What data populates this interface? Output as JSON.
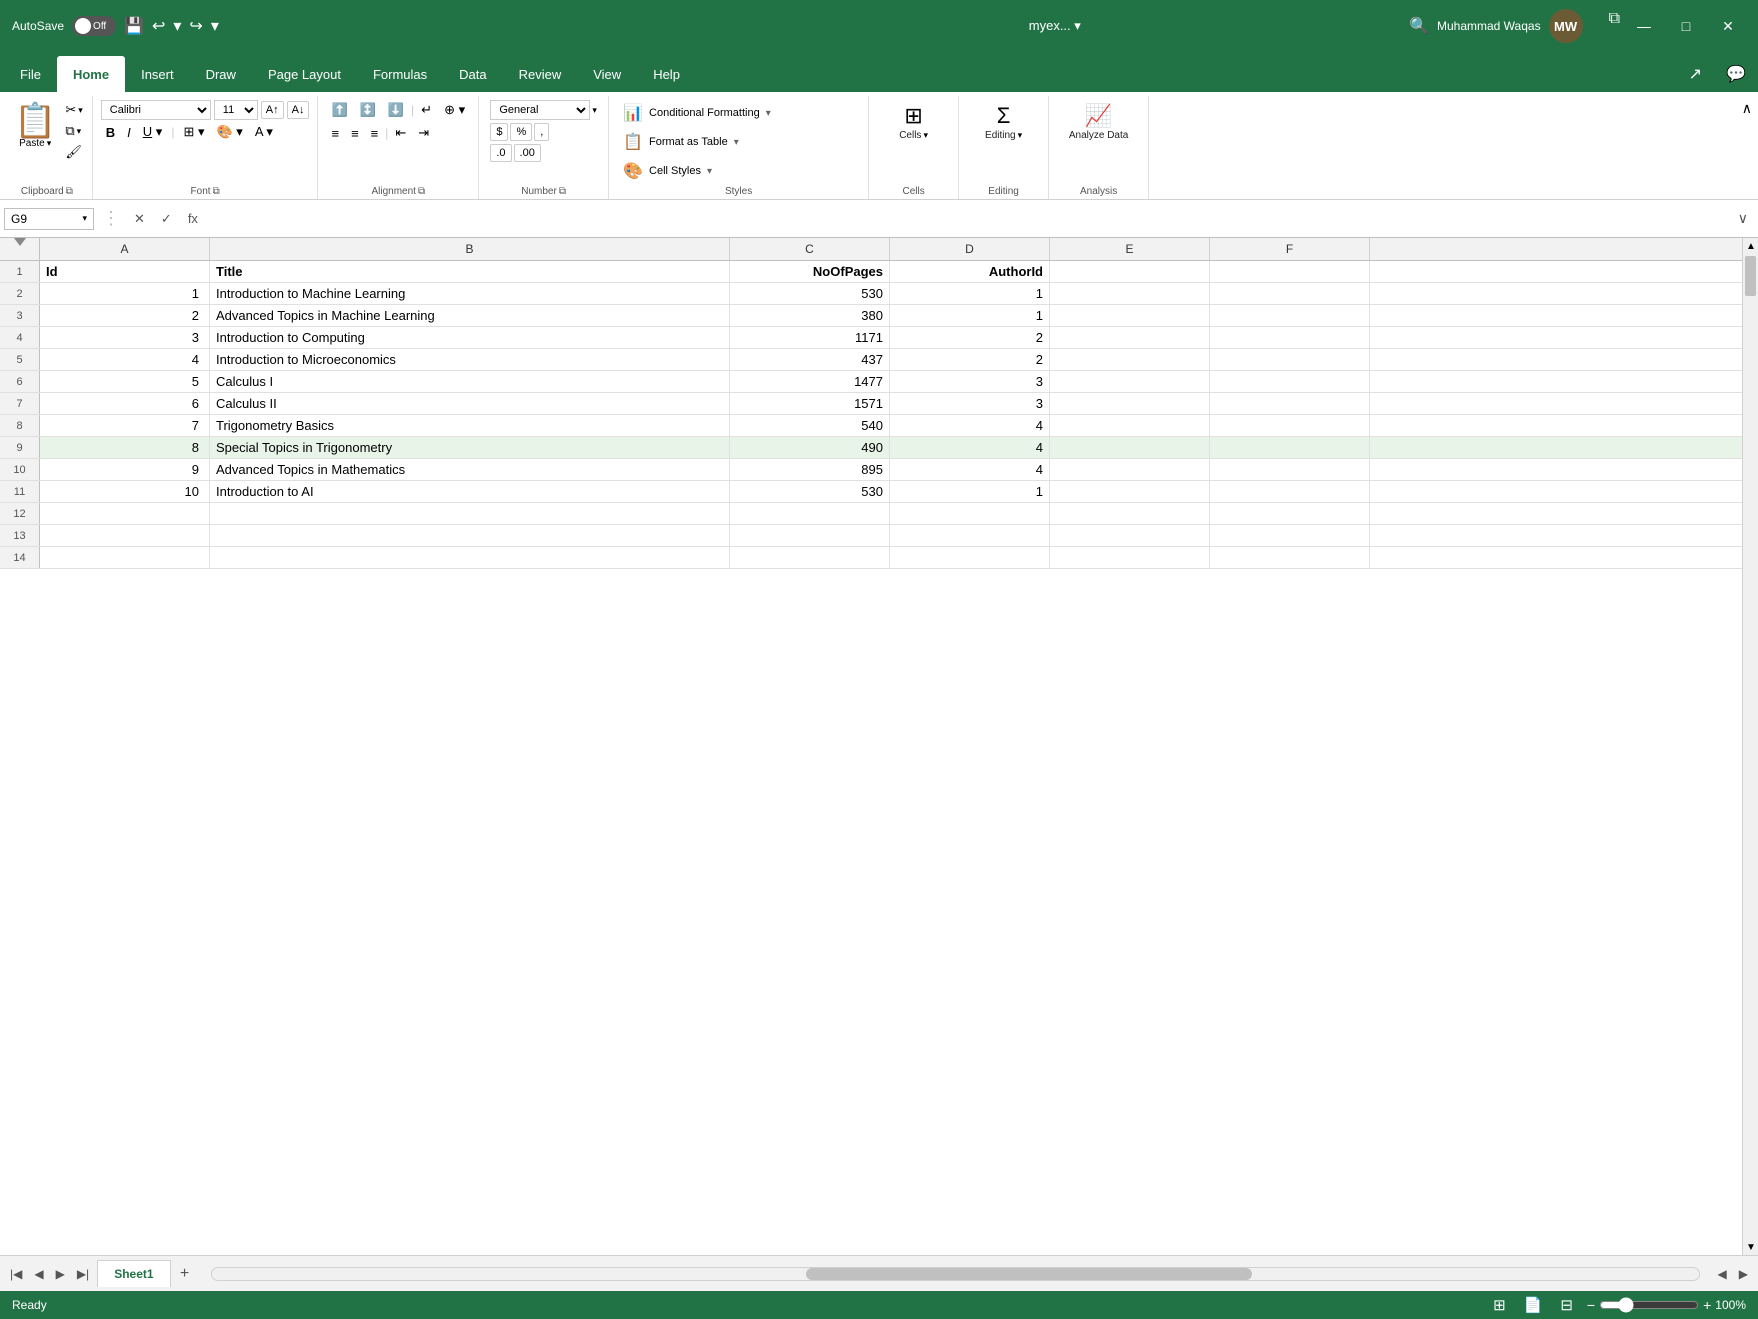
{
  "titlebar": {
    "autosave_label": "AutoSave",
    "toggle_state": "Off",
    "filename": "myex...",
    "search_placeholder": "Search",
    "username": "Muhammad Waqas",
    "user_initials": "MW"
  },
  "ribbon_tabs": {
    "tabs": [
      "File",
      "Home",
      "Insert",
      "Draw",
      "Page Layout",
      "Formulas",
      "Data",
      "Review",
      "View",
      "Help"
    ],
    "active_tab": "Home"
  },
  "ribbon": {
    "clipboard": {
      "group_label": "Clipboard",
      "paste_label": "Paste"
    },
    "font": {
      "group_label": "Font",
      "font_name": "Calibri",
      "font_size": "11",
      "bold": "B",
      "italic": "I",
      "underline": "U"
    },
    "alignment": {
      "group_label": "Alignment"
    },
    "number": {
      "group_label": "Number"
    },
    "styles": {
      "group_label": "Styles",
      "conditional_formatting": "Conditional Formatting",
      "format_as_table": "Format as Table",
      "cell_styles": "Cell Styles"
    },
    "cells": {
      "group_label": "Cells",
      "label": "Cells"
    },
    "editing": {
      "group_label": "Editing",
      "label": "Editing"
    },
    "analysis": {
      "group_label": "Analysis",
      "analyze_data": "Analyze Data"
    }
  },
  "formula_bar": {
    "cell_ref": "G9",
    "formula": "",
    "fx_label": "fx"
  },
  "spreadsheet": {
    "columns": [
      "A",
      "B",
      "C",
      "D",
      "E",
      "F"
    ],
    "headers": [
      "Id",
      "Title",
      "NoOfPages",
      "AuthorId",
      "",
      ""
    ],
    "rows": [
      {
        "row": 1,
        "cells": [
          "Id",
          "Title",
          "NoOfPages",
          "AuthorId",
          "",
          ""
        ]
      },
      {
        "row": 2,
        "cells": [
          "1",
          "Introduction to Machine Learning",
          "530",
          "1",
          "",
          ""
        ]
      },
      {
        "row": 3,
        "cells": [
          "2",
          "Advanced Topics in Machine Learning",
          "380",
          "1",
          "",
          ""
        ]
      },
      {
        "row": 4,
        "cells": [
          "3",
          "Introduction to Computing",
          "1171",
          "2",
          "",
          ""
        ]
      },
      {
        "row": 5,
        "cells": [
          "4",
          "Introduction to Microeconomics",
          "437",
          "2",
          "",
          ""
        ]
      },
      {
        "row": 6,
        "cells": [
          "5",
          "Calculus I",
          "1477",
          "3",
          "",
          ""
        ]
      },
      {
        "row": 7,
        "cells": [
          "6",
          "Calculus II",
          "1571",
          "3",
          "",
          ""
        ]
      },
      {
        "row": 8,
        "cells": [
          "7",
          "Trigonometry Basics",
          "540",
          "4",
          "",
          ""
        ]
      },
      {
        "row": 9,
        "cells": [
          "8",
          "Special Topics in Trigonometry",
          "490",
          "4",
          "",
          ""
        ]
      },
      {
        "row": 10,
        "cells": [
          "9",
          "Advanced Topics in Mathematics",
          "895",
          "4",
          "",
          ""
        ]
      },
      {
        "row": 11,
        "cells": [
          "10",
          "Introduction to AI",
          "530",
          "1",
          "",
          ""
        ]
      },
      {
        "row": 12,
        "cells": [
          "",
          "",
          "",
          "",
          "",
          ""
        ]
      },
      {
        "row": 13,
        "cells": [
          "",
          "",
          "",
          "",
          "",
          ""
        ]
      },
      {
        "row": 14,
        "cells": [
          "",
          "",
          "",
          "",
          "",
          ""
        ]
      }
    ],
    "active_cell": "G9",
    "active_row": 9
  },
  "sheets": {
    "tabs": [
      "Sheet1"
    ],
    "active": "Sheet1"
  },
  "statusbar": {
    "ready": "Ready",
    "zoom": "100%"
  }
}
